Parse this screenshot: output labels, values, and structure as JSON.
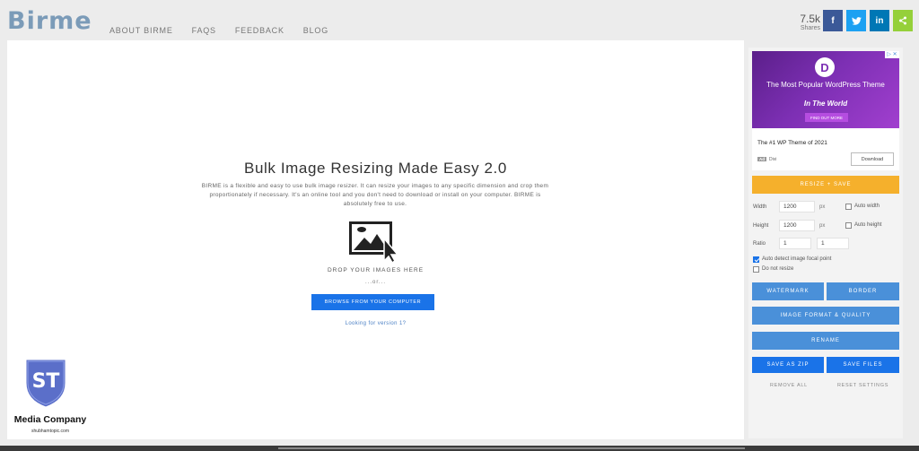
{
  "header": {
    "logo": "Birme",
    "nav": [
      "ABOUT BIRME",
      "FAQS",
      "FEEDBACK",
      "BLOG"
    ],
    "shares_count": "7.5k",
    "shares_label": "Shares",
    "social": [
      {
        "icon": "facebook-icon",
        "glyph": "f",
        "color": "#3b5998"
      },
      {
        "icon": "twitter-icon",
        "glyph": "t",
        "color": "#1da1f2"
      },
      {
        "icon": "linkedin-icon",
        "glyph": "in",
        "color": "#0077b5"
      },
      {
        "icon": "share-icon",
        "glyph": "<",
        "color": "#95d03a"
      }
    ]
  },
  "main": {
    "headline": "Bulk Image Resizing Made Easy 2.0",
    "description": "BIRME is a flexible and easy to use bulk image resizer. It can resize your images to any specific dimension and crop them proportionately if necessary. It's an online tool and you don't need to download or install on your computer. BIRME is absolutely free to use.",
    "drop_text": "DROP YOUR IMAGES HERE",
    "or_text": "...or...",
    "browse_label": "BROWSE FROM YOUR COMPUTER",
    "version_link": "Looking for version 1?"
  },
  "watermark": {
    "badge": "ST",
    "name": "Media Company",
    "url": "shubhamtopic.com"
  },
  "ad": {
    "logo_letter": "D",
    "headline_1": "The Most Popular WordPress Theme",
    "headline_2": "In The World",
    "cta": "FIND OUT MORE",
    "close": "▷ ✕",
    "title": "The #1 WP Theme of 2021",
    "sponsor_badge": "Ad",
    "sponsor": "Divi",
    "download_label": "Download"
  },
  "sidebar": {
    "resize_button": "RESIZE + SAVE",
    "width_label": "Width",
    "width_value": "1200",
    "height_label": "Height",
    "height_value": "1200",
    "unit": "px",
    "ratio_label": "Ratio",
    "ratio_w": "1",
    "ratio_h": "1",
    "auto_width": "Auto width",
    "auto_height": "Auto height",
    "focal_point": "Auto detect image focal point",
    "do_not_resize": "Do not resize",
    "watermark_button": "WATERMARK",
    "border_button": "BORDER",
    "format_button": "IMAGE FORMAT & QUALITY",
    "rename_button": "RENAME",
    "save_zip_button": "SAVE AS ZIP",
    "save_files_button": "SAVE FILES",
    "remove_all": "REMOVE ALL",
    "reset_settings": "RESET SETTINGS"
  },
  "colors": {
    "accent_blue": "#1a73e8",
    "button_blue": "#4a90d9",
    "resize_orange": "#f5b02c",
    "logo": "#7b9bb8"
  }
}
